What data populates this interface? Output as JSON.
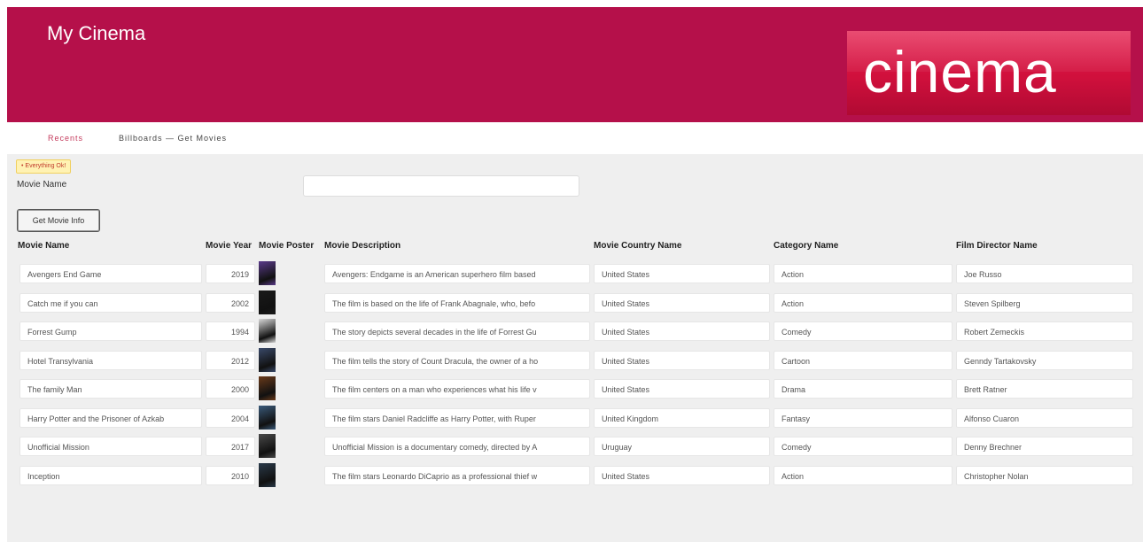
{
  "header": {
    "app_title": "My Cinema",
    "logo_text": "cinema",
    "brand_color": "#b5104a"
  },
  "nav": {
    "recents_label": "Recents",
    "breadcrumb": "Billboards — Get Movies"
  },
  "status_badge": "• Everything Ok!",
  "search": {
    "label": "Movie Name",
    "value": "",
    "placeholder": ""
  },
  "get_button_label": "Get Movie Info",
  "table": {
    "columns": [
      "Movie Name",
      "Movie Year",
      "Movie Poster",
      "Movie Description",
      "Movie Country Name",
      "Category Name",
      "Film Director Name"
    ],
    "rows": [
      {
        "name": "Avengers End Game",
        "year": "2019",
        "poster": "poster-avengers",
        "poster_color": "#5a3a8a",
        "description": "Avengers: Endgame is an American superhero film based",
        "country": "United States",
        "category": "Action",
        "director": "Joe Russo"
      },
      {
        "name": "Catch me if you can",
        "year": "2002",
        "poster": "poster-catch-me",
        "poster_color": "#1a1a1a",
        "description": "The film is based on the life of Frank Abagnale, who, befo",
        "country": "United States",
        "category": "Action",
        "director": "Steven Spilberg"
      },
      {
        "name": "Forrest Gump",
        "year": "1994",
        "poster": "poster-forrest-gump",
        "poster_color": "#d8d8d8",
        "description": "The story depicts several decades in the life of Forrest Gu",
        "country": "United States",
        "category": "Comedy",
        "director": "Robert Zemeckis"
      },
      {
        "name": "Hotel Transylvania",
        "year": "2012",
        "poster": "poster-hotel-transylvania",
        "poster_color": "#3a4a6a",
        "description": "The film tells the story of Count Dracula, the owner of a ho",
        "country": "United States",
        "category": "Cartoon",
        "director": "Genndy Tartakovsky"
      },
      {
        "name": "The family Man",
        "year": "2000",
        "poster": "poster-family-man",
        "poster_color": "#6a3a1a",
        "description": "The film centers on a man who experiences what his life v",
        "country": "United States",
        "category": "Drama",
        "director": "Brett Ratner"
      },
      {
        "name": "Harry Potter and the Prisoner of Azkab",
        "year": "2004",
        "poster": "poster-harry-potter",
        "poster_color": "#3a5a7a",
        "description": "The film stars Daniel Radcliffe as Harry Potter, with Ruper",
        "country": "United Kingdom",
        "category": "Fantasy",
        "director": "Alfonso Cuaron"
      },
      {
        "name": "Unofficial Mission",
        "year": "2017",
        "poster": "poster-unofficial-mission",
        "poster_color": "#4a4a4a",
        "description": "Unofficial Mission is a documentary comedy, directed by A",
        "country": "Uruguay",
        "category": "Comedy",
        "director": "Denny Brechner"
      },
      {
        "name": "Inception",
        "year": "2010",
        "poster": "poster-inception",
        "poster_color": "#2a3a4a",
        "description": "The film stars Leonardo DiCaprio as a professional thief w",
        "country": "United States",
        "category": "Action",
        "director": "Christopher Nolan"
      }
    ]
  }
}
